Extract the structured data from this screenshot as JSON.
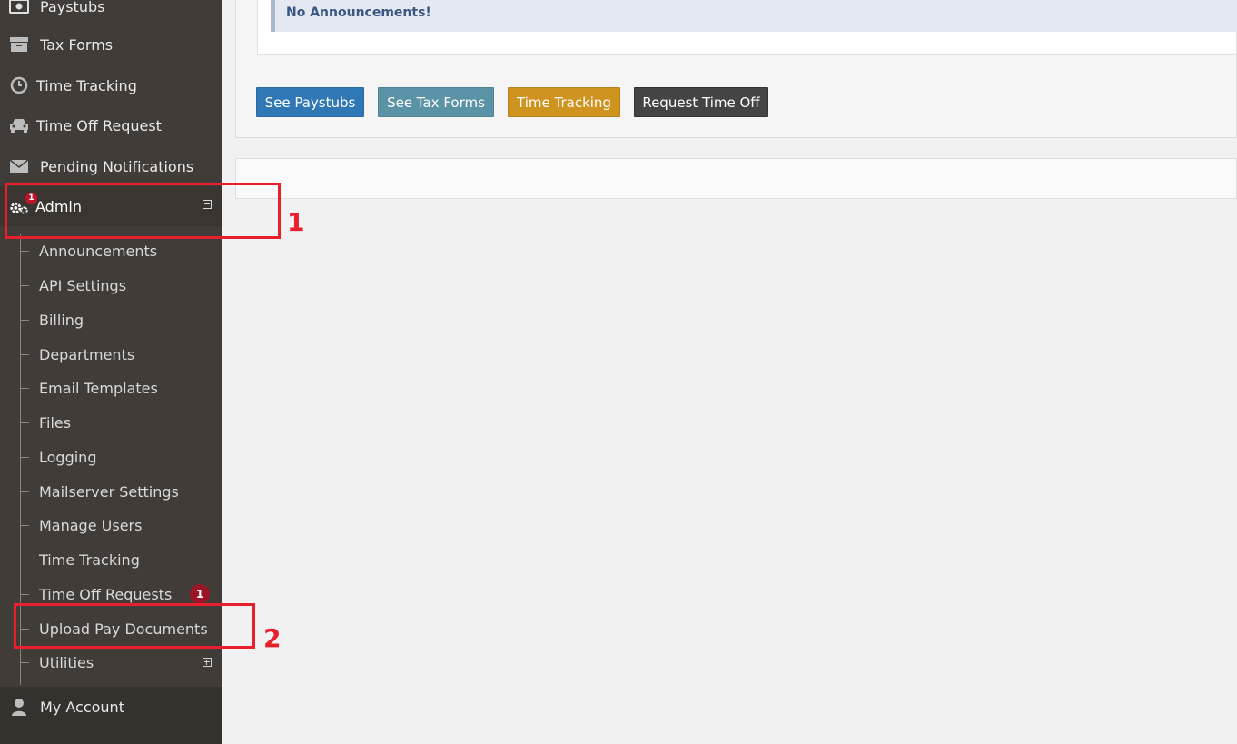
{
  "sidebar": {
    "items": [
      {
        "label": "Paystubs",
        "icon": "money-icon"
      },
      {
        "label": "Tax Forms",
        "icon": "archive-icon"
      },
      {
        "label": "Time Tracking",
        "icon": "clock-icon"
      },
      {
        "label": "Time Off Request",
        "icon": "car-icon"
      },
      {
        "label": "Pending Notifications",
        "icon": "envelope-icon"
      }
    ],
    "admin": {
      "label": "Admin",
      "badge": "1",
      "icon": "gears-icon"
    },
    "admin_subitems": [
      {
        "label": "Announcements"
      },
      {
        "label": "API Settings"
      },
      {
        "label": "Billing"
      },
      {
        "label": "Departments"
      },
      {
        "label": "Email Templates"
      },
      {
        "label": "Files"
      },
      {
        "label": "Logging"
      },
      {
        "label": "Mailserver Settings"
      },
      {
        "label": "Manage Users"
      },
      {
        "label": "Time Tracking"
      },
      {
        "label": "Time Off Requests",
        "badge": "1"
      },
      {
        "label": "Upload Pay Documents"
      },
      {
        "label": "Utilities"
      }
    ],
    "bottom_items": [
      {
        "label": "My Account",
        "icon": "user-icon"
      }
    ]
  },
  "main": {
    "announcement": "No Announcements!",
    "buttons": [
      {
        "label": "See Paystubs",
        "color": "#2f77b5"
      },
      {
        "label": "See Tax Forms",
        "color": "#5a93a5"
      },
      {
        "label": "Time Tracking",
        "color": "#cf9320"
      },
      {
        "label": "Request Time Off",
        "color": "#444444"
      }
    ]
  },
  "annotations": {
    "step1": "1",
    "step2": "2"
  }
}
